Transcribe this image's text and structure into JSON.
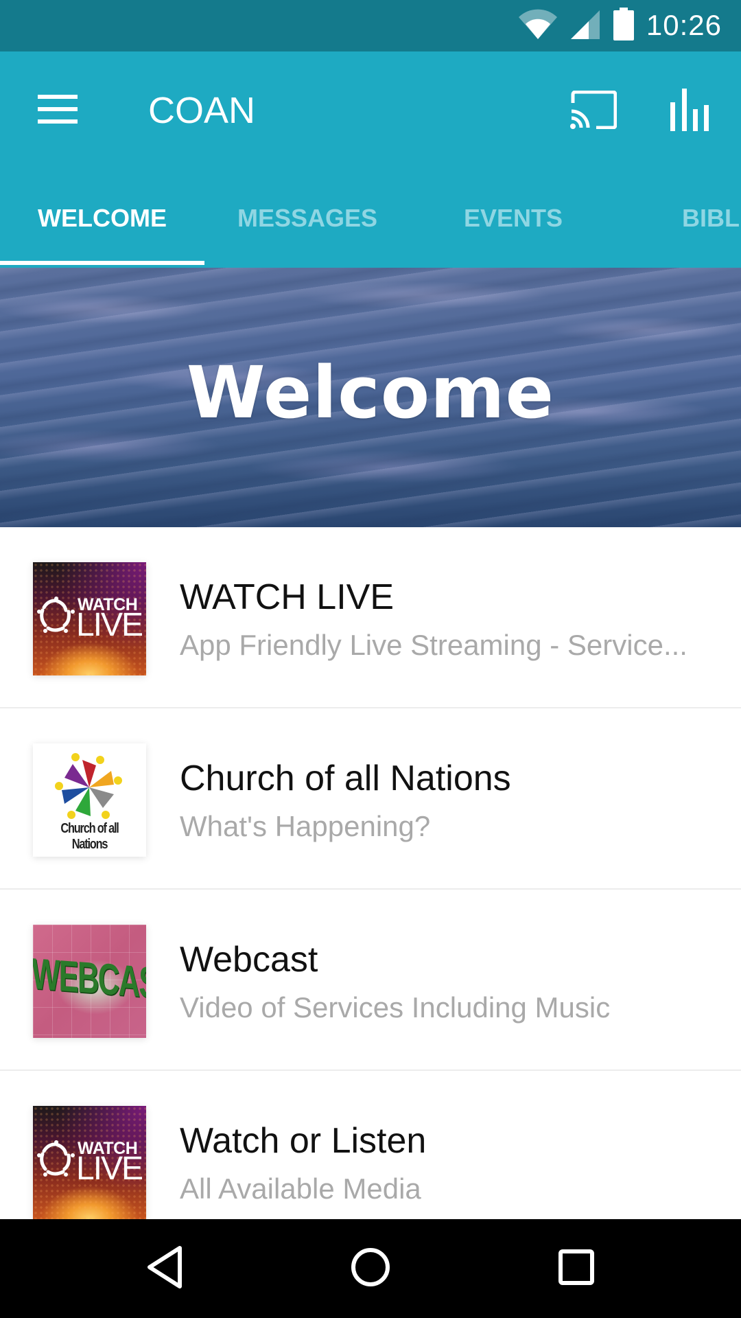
{
  "status_bar": {
    "time": "10:26",
    "icons": [
      "wifi-icon",
      "cellular-signal-icon",
      "battery-icon"
    ]
  },
  "app_bar": {
    "title": "COAN",
    "menu_icon": "hamburger-menu-icon",
    "actions": [
      {
        "name": "cast",
        "icon": "cast-icon"
      },
      {
        "name": "stats",
        "icon": "bar-chart-icon"
      }
    ]
  },
  "tabs": [
    {
      "label": "WELCOME",
      "active": true
    },
    {
      "label": "MESSAGES",
      "active": false
    },
    {
      "label": "EVENTS",
      "active": false
    },
    {
      "label": "BIBLE",
      "active": false
    }
  ],
  "hero": {
    "title": "Welcome"
  },
  "list": [
    {
      "title": "WATCH LIVE",
      "subtitle": "App Friendly Live Streaming - Service...",
      "thumbnail": {
        "type": "watch-live",
        "line1": "WATCH",
        "line2": "LIVE"
      }
    },
    {
      "title": "Church of all Nations",
      "subtitle": "What's Happening?",
      "thumbnail": {
        "type": "church-logo",
        "text": "Church of all Nations"
      }
    },
    {
      "title": "Webcast",
      "subtitle": "Video of Services Including Music",
      "thumbnail": {
        "type": "webcast",
        "text": "WEBCAST"
      }
    },
    {
      "title": "Watch or Listen",
      "subtitle": "All Available Media",
      "thumbnail": {
        "type": "watch-live",
        "line1": "WATCH",
        "line2": "LIVE"
      }
    }
  ],
  "nav_bar": {
    "buttons": [
      "back-icon",
      "home-icon",
      "recents-icon"
    ]
  },
  "colors": {
    "status_bar": "#147a8c",
    "primary": "#1eaac2",
    "tab_inactive": "#8fd6e3",
    "tab_active": "#ffffff",
    "title_text": "#111111",
    "subtitle_text": "#a9a9a9"
  }
}
